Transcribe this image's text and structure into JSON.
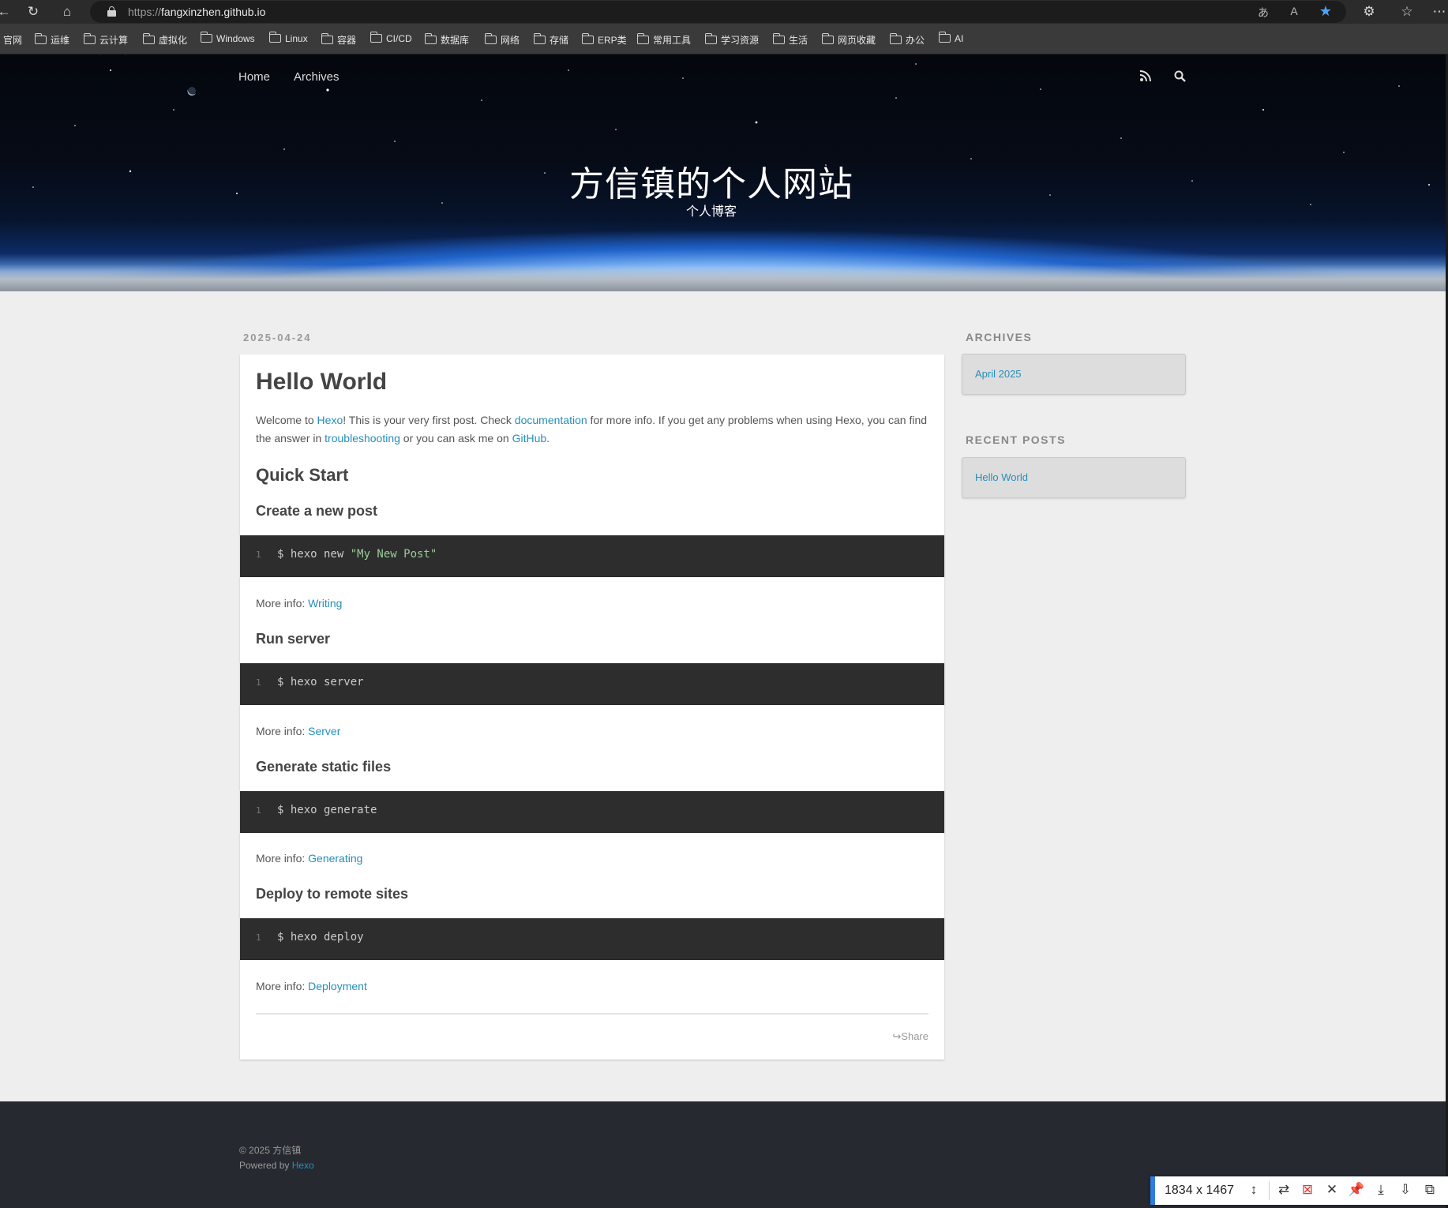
{
  "browser": {
    "url_scheme": "https://",
    "url_host": "fangxinzhen.github.io",
    "icons": [
      "back-icon",
      "refresh-icon",
      "home-icon",
      "lock-icon",
      "translate-icon",
      "read-aloud-icon",
      "favorite-star-icon",
      "extensions-icon",
      "favorites-icon",
      "more-icon"
    ]
  },
  "bookmarks": [
    "官网",
    "运维",
    "云计算",
    "虚拟化",
    "Windows",
    "Linux",
    "容器",
    "CI/CD",
    "数据库",
    "网络",
    "存储",
    "ERP类",
    "常用工具",
    "学习资源",
    "生活",
    "网页收藏",
    "办公",
    "AI"
  ],
  "nav": {
    "home": "Home",
    "archives": "Archives"
  },
  "site": {
    "title": "方信镇的个人网站",
    "subtitle": "个人博客"
  },
  "post": {
    "date": "2025-04-24",
    "title": "Hello World",
    "intro": {
      "t1": "Welcome to ",
      "link_hexo": "Hexo",
      "t2": "! This is your very first post. Check ",
      "link_docs": "documentation",
      "t3": " for more info. If you get any problems when using Hexo, you can find the answer in ",
      "link_trouble": "troubleshooting",
      "t4": " or you can ask me on ",
      "link_github": "GitHub",
      "t5": "."
    },
    "quick_start": "Quick Start",
    "more_info_label": "More info: ",
    "sections": [
      {
        "heading": "Create a new post",
        "line": "1",
        "cmd": "$ hexo new ",
        "cmd_str": "\"My New Post\"",
        "link": "Writing"
      },
      {
        "heading": "Run server",
        "line": "1",
        "cmd": "$ hexo server",
        "link": "Server"
      },
      {
        "heading": "Generate static files",
        "line": "1",
        "cmd": "$ hexo generate",
        "link": "Generating"
      },
      {
        "heading": "Deploy to remote sites",
        "line": "1",
        "cmd": "$ hexo deploy",
        "link": "Deployment"
      }
    ],
    "share": "Share"
  },
  "sidebar": {
    "archives_title": "ARCHIVES",
    "archives_item": "April 2025",
    "recent_title": "RECENT POSTS",
    "recent_item": "Hello World"
  },
  "footer": {
    "copyright": "© 2025 方信镇",
    "powered_by": "Powered by ",
    "powered_link": "Hexo"
  },
  "capture_toolbar": {
    "size": "1834 x 1467"
  },
  "colors": {
    "link": "#258fb8",
    "code_bg": "#2d2d2d",
    "footer_bg": "#262a30",
    "page_bg": "#eeeeee"
  }
}
